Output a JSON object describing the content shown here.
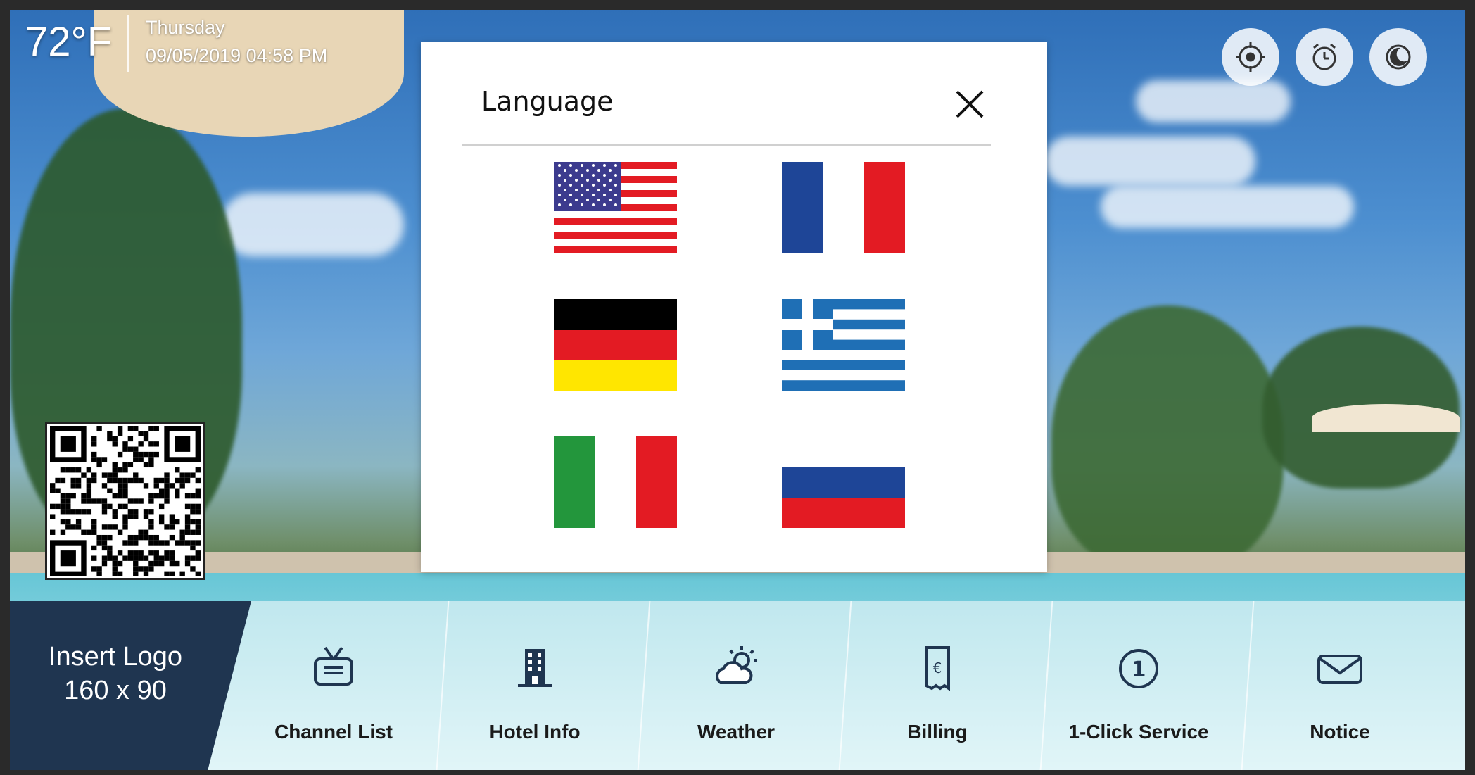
{
  "status": {
    "temperature": "72°F",
    "day": "Thursday",
    "datetime": "09/05/2019 04:58 PM"
  },
  "top_buttons": [
    {
      "icon": "target-icon"
    },
    {
      "icon": "alarm-clock-icon"
    },
    {
      "icon": "sleep-moon-icon"
    }
  ],
  "logo": {
    "line1": "Insert Logo",
    "line2": "160 x 90"
  },
  "menu": [
    {
      "label": "Channel List",
      "icon": "tv-icon"
    },
    {
      "label": "Hotel Info",
      "icon": "building-icon"
    },
    {
      "label": "Weather",
      "icon": "weather-icon"
    },
    {
      "label": "Billing",
      "icon": "euro-bill-icon"
    },
    {
      "label": "1-Click Service",
      "icon": "one-click-icon"
    },
    {
      "label": "Notice",
      "icon": "envelope-icon"
    }
  ],
  "modal": {
    "title": "Language",
    "close_icon": "close-icon",
    "languages": [
      {
        "flag": "us-flag-icon"
      },
      {
        "flag": "france-flag-icon"
      },
      {
        "flag": "germany-flag-icon"
      },
      {
        "flag": "greece-flag-icon"
      },
      {
        "flag": "italy-flag-icon"
      },
      {
        "flag": "russia-flag-icon"
      }
    ]
  },
  "colors": {
    "logo_bg": "#1f3550",
    "menu_icon": "#1f3550",
    "modal_bg": "#ffffff"
  }
}
